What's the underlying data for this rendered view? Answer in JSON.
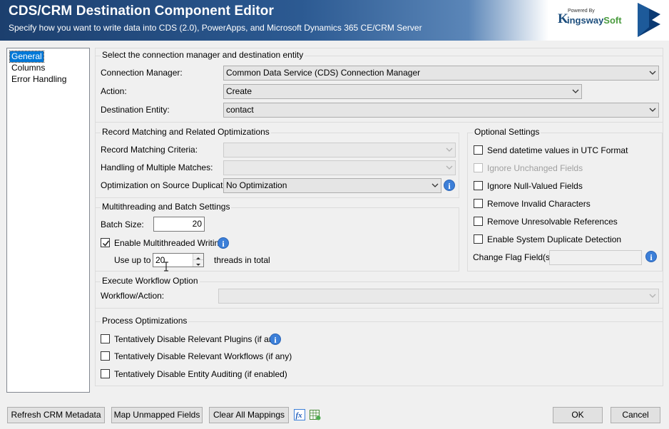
{
  "header": {
    "title": "CDS/CRM Destination Component Editor",
    "subtitle": "Specify how you want to write data into CDS (2.0), PowerApps, and Microsoft Dynamics 365 CE/CRM Server",
    "logo_powered": "Powered By",
    "logo_k": "K",
    "logo_name": "ingsway",
    "logo_soft": "Soft"
  },
  "nav": {
    "items": [
      {
        "label": "General",
        "selected": true
      },
      {
        "label": "Columns",
        "selected": false
      },
      {
        "label": "Error Handling",
        "selected": false
      }
    ]
  },
  "connection": {
    "group_title": "Select the connection manager and destination entity",
    "manager_label": "Connection Manager:",
    "manager_value": "Common Data Service (CDS) Connection Manager",
    "action_label": "Action:",
    "action_value": "Create",
    "entity_label": "Destination Entity:",
    "entity_value": "contact"
  },
  "matching": {
    "group_title": "Record Matching and Related Optimizations",
    "criteria_label": "Record Matching Criteria:",
    "criteria_value": "",
    "multiple_label": "Handling of Multiple Matches:",
    "multiple_value": "",
    "duplicates_label": "Optimization on Source Duplicates:",
    "duplicates_value": "No Optimization"
  },
  "multithreading": {
    "group_title": "Multithreading and Batch Settings",
    "batch_label": "Batch Size:",
    "batch_value": "20",
    "enable_label": "Enable Multithreaded Writing",
    "enable_checked": true,
    "use_up_to_label": "Use up to",
    "threads_value": "20",
    "threads_suffix": "threads in total"
  },
  "optional": {
    "group_title": "Optional Settings",
    "options": [
      {
        "label": "Send datetime values in UTC Format",
        "checked": false,
        "disabled": false
      },
      {
        "label": "Ignore Unchanged Fields",
        "checked": false,
        "disabled": true
      },
      {
        "label": "Ignore Null-Valued Fields",
        "checked": false,
        "disabled": false
      },
      {
        "label": "Remove Invalid Characters",
        "checked": false,
        "disabled": false
      },
      {
        "label": "Remove Unresolvable References",
        "checked": false,
        "disabled": false
      },
      {
        "label": "Enable System Duplicate Detection",
        "checked": false,
        "disabled": false
      }
    ],
    "change_flag_label": "Change Flag Field(s):",
    "change_flag_value": ""
  },
  "workflow": {
    "group_title": "Execute Workflow Option",
    "action_label": "Workflow/Action:",
    "action_value": ""
  },
  "process": {
    "group_title": "Process Optimizations",
    "options": [
      {
        "label": "Tentatively Disable Relevant Plugins (if any)",
        "checked": false
      },
      {
        "label": "Tentatively Disable Relevant Workflows (if any)",
        "checked": false
      },
      {
        "label": "Tentatively Disable Entity Auditing (if enabled)",
        "checked": false
      }
    ]
  },
  "footer": {
    "refresh_label": "Refresh CRM Metadata",
    "map_label": "Map Unmapped Fields",
    "clear_label": "Clear All Mappings",
    "ok_label": "OK",
    "cancel_label": "Cancel"
  },
  "icons": {
    "info": "info-icon",
    "dropdown": "chevron-down-icon",
    "expression": "fx-icon",
    "grid": "grid-icon",
    "dynamics": "dynamics-logo-icon"
  },
  "colors": {
    "header_dark": "#1c3f6e",
    "selection": "#0078d7",
    "info_blue": "#3c7fd8"
  }
}
